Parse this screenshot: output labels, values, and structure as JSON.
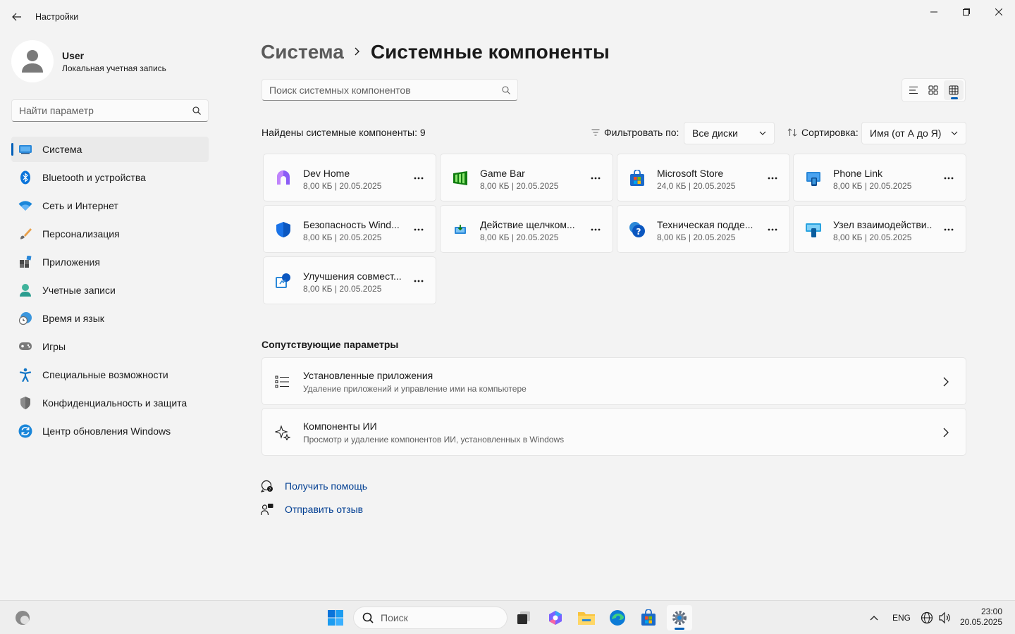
{
  "app": {
    "title": "Настройки"
  },
  "profile": {
    "name": "User",
    "account": "Локальная учетная запись"
  },
  "sidebar": {
    "search_placeholder": "Найти параметр",
    "items": [
      {
        "label": "Система",
        "icon": "display-icon",
        "active": true
      },
      {
        "label": "Bluetooth и устройства",
        "icon": "bluetooth-icon"
      },
      {
        "label": "Сеть и Интернет",
        "icon": "wifi-icon"
      },
      {
        "label": "Персонализация",
        "icon": "brush-icon"
      },
      {
        "label": "Приложения",
        "icon": "apps-icon"
      },
      {
        "label": "Учетные записи",
        "icon": "person-icon"
      },
      {
        "label": "Время и язык",
        "icon": "globe-clock-icon"
      },
      {
        "label": "Игры",
        "icon": "gamepad-icon"
      },
      {
        "label": "Специальные возможности",
        "icon": "accessibility-icon"
      },
      {
        "label": "Конфиденциальность и защита",
        "icon": "shield-icon"
      },
      {
        "label": "Центр обновления Windows",
        "icon": "update-icon"
      }
    ]
  },
  "breadcrumb": {
    "parent": "Система",
    "current": "Системные компоненты"
  },
  "main": {
    "search_placeholder": "Поиск системных компонентов",
    "found_text": "Найдены системные компоненты: 9",
    "filter_label": "Фильтровать по:",
    "filter_value": "Все диски",
    "sort_label": "Сортировка:",
    "sort_value": "Имя (от А до Я)"
  },
  "components": [
    {
      "name": "Dev Home",
      "meta": "8,00 КБ   |   20.05.2025",
      "icon": "dev-home-icon"
    },
    {
      "name": "Game Bar",
      "meta": "8,00 КБ   |   20.05.2025",
      "icon": "game-bar-icon"
    },
    {
      "name": "Microsoft Store",
      "meta": "24,0 КБ   |   20.05.2025",
      "icon": "store-icon"
    },
    {
      "name": "Phone Link",
      "meta": "8,00 КБ   |   20.05.2025",
      "icon": "phone-link-icon"
    },
    {
      "name": "Безопасность Wind...",
      "meta": "8,00 КБ   |   20.05.2025",
      "icon": "security-shield-icon"
    },
    {
      "name": "Действие щелчком...",
      "meta": "8,00 КБ   |   20.05.2025",
      "icon": "click-to-do-icon"
    },
    {
      "name": "Техническая подде...",
      "meta": "8,00 КБ   |   20.05.2025",
      "icon": "get-help-icon"
    },
    {
      "name": "Узел взаимодействи...",
      "meta": "8,00 КБ   |   20.05.2025",
      "icon": "experience-host-icon"
    },
    {
      "name": "Улучшения совмест...",
      "meta": "8,00 КБ   |   20.05.2025",
      "icon": "compat-icon"
    }
  ],
  "related": {
    "title": "Сопутствующие параметры",
    "items": [
      {
        "title": "Установленные приложения",
        "subtitle": "Удаление приложений и управление ими на компьютере",
        "icon": "list-icon"
      },
      {
        "title": "Компоненты ИИ",
        "subtitle": "Просмотр и удаление компонентов ИИ, установленных в Windows",
        "icon": "sparkle-icon"
      }
    ]
  },
  "help": {
    "get_help": "Получить помощь",
    "feedback": "Отправить отзыв"
  },
  "taskbar": {
    "search_label": "Поиск",
    "lang": "ENG",
    "time": "23:00",
    "date": "20.05.2025"
  },
  "colors": {
    "accent": "#005fb8",
    "link": "#003e92"
  }
}
